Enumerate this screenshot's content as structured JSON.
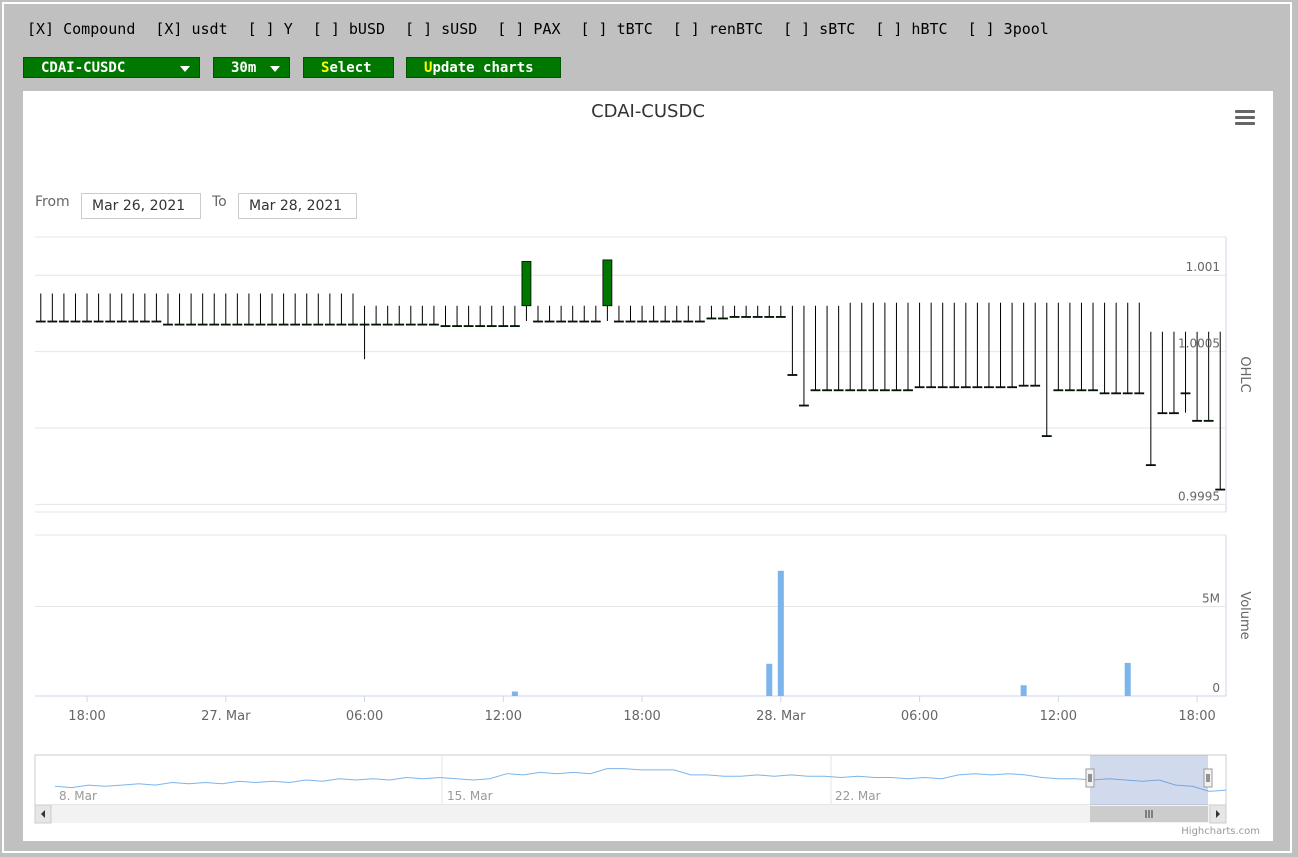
{
  "pools": [
    {
      "label": "[X] Compound"
    },
    {
      "label": "[X] usdt"
    },
    {
      "label": "[ ] Y"
    },
    {
      "label": "[ ] bUSD"
    },
    {
      "label": "[ ] sUSD"
    },
    {
      "label": "[ ] PAX"
    },
    {
      "label": "[ ] tBTC"
    },
    {
      "label": "[ ] renBTC"
    },
    {
      "label": "[ ] sBTC"
    },
    {
      "label": "[ ] hBTC"
    },
    {
      "label": "[ ] 3pool"
    }
  ],
  "controls": {
    "pair": "CDAI-CUSDC",
    "interval": "30m",
    "select_first": "S",
    "select_rest": "elect",
    "update_first": "U",
    "update_rest": "pdate charts",
    "accent": "#007800",
    "highlight": "#ffff00"
  },
  "range": {
    "from_label": "From",
    "from_value": "Mar 26, 2021",
    "to_label": "To",
    "to_value": "Mar 28, 2021"
  },
  "credit": "Highcharts.com",
  "chart_data": {
    "type": "candlestick",
    "title": "CDAI-CUSDC",
    "up_color": "#007800",
    "down_color": "#bb0000",
    "volume_color": "#7cb5ec",
    "ohlc": {
      "axis_title": "OHLC",
      "ylim": [
        0.99945,
        1.00125
      ],
      "ticks": [
        0.9995,
        1.0,
        1.0005,
        1.001
      ],
      "tick_labels": [
        "0.9995",
        "",
        "1.0005",
        "1.001"
      ],
      "candles": [
        [
          0,
          1.0007,
          1.00088,
          1.00088,
          1.0007
        ],
        [
          1,
          1.0007,
          1.00088,
          1.00088,
          1.0007
        ],
        [
          2,
          1.0007,
          1.00088,
          1.00088,
          1.0007
        ],
        [
          3,
          1.0007,
          1.00088,
          1.00088,
          1.0007
        ],
        [
          4,
          1.0007,
          1.00088,
          1.00088,
          1.0007
        ],
        [
          5,
          1.0007,
          1.00088,
          1.00088,
          1.0007
        ],
        [
          6,
          1.0007,
          1.00088,
          1.00088,
          1.0007
        ],
        [
          7,
          1.0007,
          1.00088,
          1.00088,
          1.0007
        ],
        [
          8,
          1.0007,
          1.00088,
          1.00088,
          1.0007
        ],
        [
          9,
          1.0007,
          1.00088,
          1.00088,
          1.0007
        ],
        [
          10,
          1.0007,
          1.00088,
          1.00088,
          1.0007
        ],
        [
          11,
          1.00068,
          1.00088,
          1.00088,
          1.00068
        ],
        [
          12,
          1.00068,
          1.00088,
          1.00088,
          1.00068
        ],
        [
          13,
          1.00068,
          1.00088,
          1.00088,
          1.00068
        ],
        [
          14,
          1.00068,
          1.00088,
          1.00088,
          1.00068
        ],
        [
          15,
          1.00068,
          1.00088,
          1.00088,
          1.00068
        ],
        [
          16,
          1.00068,
          1.00088,
          1.00088,
          1.00068
        ],
        [
          17,
          1.00068,
          1.00088,
          1.00088,
          1.00068
        ],
        [
          18,
          1.00068,
          1.00088,
          1.00088,
          1.00068
        ],
        [
          19,
          1.00068,
          1.00088,
          1.00088,
          1.00068
        ],
        [
          20,
          1.00068,
          1.00088,
          1.00088,
          1.00068
        ],
        [
          21,
          1.00068,
          1.00088,
          1.00088,
          1.00068
        ],
        [
          22,
          1.00068,
          1.00088,
          1.00088,
          1.00068
        ],
        [
          23,
          1.00068,
          1.00088,
          1.00088,
          1.00068
        ],
        [
          24,
          1.00068,
          1.00088,
          1.00088,
          1.00068
        ],
        [
          25,
          1.00068,
          1.00088,
          1.00088,
          1.00068
        ],
        [
          26,
          1.00068,
          1.00088,
          1.00088,
          1.00068
        ],
        [
          27,
          1.00068,
          1.00088,
          1.00088,
          1.00068
        ],
        [
          28,
          1.00068,
          1.0008,
          1.00045,
          1.00068
        ],
        [
          29,
          1.00068,
          1.0008,
          1.0008,
          1.00068
        ],
        [
          30,
          1.00068,
          1.0008,
          1.0008,
          1.00068
        ],
        [
          31,
          1.00068,
          1.0008,
          1.0008,
          1.00068
        ],
        [
          32,
          1.00068,
          1.0008,
          1.0008,
          1.00068
        ],
        [
          33,
          1.00068,
          1.0008,
          1.0008,
          1.00068
        ],
        [
          34,
          1.00068,
          1.0008,
          1.0008,
          1.00068
        ],
        [
          35,
          1.00067,
          1.0008,
          1.0008,
          1.00067
        ],
        [
          36,
          1.00067,
          1.0008,
          1.0008,
          1.00067
        ],
        [
          37,
          1.00067,
          1.0008,
          1.0008,
          1.00067
        ],
        [
          38,
          1.00067,
          1.0008,
          1.0008,
          1.00067
        ],
        [
          39,
          1.00067,
          1.0008,
          1.0008,
          1.00067
        ],
        [
          40,
          1.00067,
          1.0008,
          1.0008,
          1.00067
        ],
        [
          41,
          1.00067,
          1.0008,
          1.0008,
          1.00067
        ],
        [
          42,
          1.0008,
          1.00109,
          1.0007,
          1.00109
        ],
        [
          43,
          1.0007,
          1.0008,
          1.0008,
          1.0007
        ],
        [
          44,
          1.0007,
          1.0008,
          1.0008,
          1.0007
        ],
        [
          45,
          1.0007,
          1.0008,
          1.0008,
          1.0007
        ],
        [
          46,
          1.0007,
          1.0008,
          1.0008,
          1.0007
        ],
        [
          47,
          1.0007,
          1.0008,
          1.0008,
          1.0007
        ],
        [
          48,
          1.0007,
          1.0008,
          1.0008,
          1.0007
        ],
        [
          49,
          1.0008,
          1.0011,
          1.0007,
          1.0011
        ],
        [
          50,
          1.0007,
          1.0008,
          1.0008,
          1.0007
        ],
        [
          51,
          1.0007,
          1.0008,
          1.0008,
          1.0007
        ],
        [
          52,
          1.0007,
          1.0008,
          1.0008,
          1.0007
        ],
        [
          53,
          1.0007,
          1.0008,
          1.0008,
          1.0007
        ],
        [
          54,
          1.0007,
          1.0008,
          1.0008,
          1.0007
        ],
        [
          55,
          1.0007,
          1.0008,
          1.0008,
          1.0007
        ],
        [
          56,
          1.0007,
          1.0008,
          1.0008,
          1.0007
        ],
        [
          57,
          1.0007,
          1.0008,
          1.0008,
          1.0007
        ],
        [
          58,
          1.00072,
          1.0008,
          1.0008,
          1.00072
        ],
        [
          59,
          1.00072,
          1.0008,
          1.0008,
          1.00072
        ],
        [
          60,
          1.00073,
          1.0008,
          1.0008,
          1.00073
        ],
        [
          61,
          1.00073,
          1.0008,
          1.0008,
          1.00073
        ],
        [
          62,
          1.00073,
          1.0008,
          1.0008,
          1.00073
        ],
        [
          63,
          1.00073,
          1.0008,
          1.0008,
          1.00073
        ],
        [
          64,
          1.00073,
          1.0008,
          1.0008,
          1.00073
        ],
        [
          65,
          1.00035,
          1.0008,
          1.0008,
          1.00035
        ],
        [
          66,
          1.00015,
          1.0008,
          1.0008,
          1.00015
        ],
        [
          67,
          1.00025,
          1.0008,
          1.0008,
          1.00025
        ],
        [
          68,
          1.00025,
          1.0008,
          1.0008,
          1.00025
        ],
        [
          69,
          1.00025,
          1.0008,
          1.0008,
          1.00025
        ],
        [
          70,
          1.00025,
          1.00082,
          1.00082,
          1.00025
        ],
        [
          71,
          1.00025,
          1.00082,
          1.00082,
          1.00025
        ],
        [
          72,
          1.00025,
          1.00082,
          1.00082,
          1.00025
        ],
        [
          73,
          1.00025,
          1.00082,
          1.00082,
          1.00025
        ],
        [
          74,
          1.00025,
          1.00082,
          1.00082,
          1.00025
        ],
        [
          75,
          1.00025,
          1.00082,
          1.00082,
          1.00025
        ],
        [
          76,
          1.00027,
          1.00082,
          1.00082,
          1.00027
        ],
        [
          77,
          1.00027,
          1.00082,
          1.00082,
          1.00027
        ],
        [
          78,
          1.00027,
          1.00082,
          1.00082,
          1.00027
        ],
        [
          79,
          1.00027,
          1.00082,
          1.00082,
          1.00027
        ],
        [
          80,
          1.00027,
          1.00082,
          1.00082,
          1.00027
        ],
        [
          81,
          1.00027,
          1.00082,
          1.00082,
          1.00027
        ],
        [
          82,
          1.00027,
          1.00082,
          1.00082,
          1.00027
        ],
        [
          83,
          1.00027,
          1.00082,
          1.00082,
          1.00027
        ],
        [
          84,
          1.00027,
          1.00082,
          1.00082,
          1.00027
        ],
        [
          85,
          1.00028,
          1.00082,
          1.00082,
          1.00028
        ],
        [
          86,
          1.00028,
          1.00082,
          1.00082,
          1.00028
        ],
        [
          87,
          0.99995,
          1.00082,
          1.00082,
          0.99995
        ],
        [
          88,
          1.00025,
          1.00082,
          1.00082,
          1.00025
        ],
        [
          89,
          1.00025,
          1.00082,
          1.00082,
          1.00025
        ],
        [
          90,
          1.00025,
          1.00082,
          1.00082,
          1.00025
        ],
        [
          91,
          1.00025,
          1.00082,
          1.00082,
          1.00025
        ],
        [
          92,
          1.00023,
          1.00082,
          1.00082,
          1.00023
        ],
        [
          93,
          1.00023,
          1.00082,
          1.00082,
          1.00023
        ],
        [
          94,
          1.00023,
          1.00082,
          1.00082,
          1.00023
        ],
        [
          95,
          1.00023,
          1.00082,
          1.00082,
          1.00023
        ],
        [
          96,
          0.99976,
          1.00063,
          1.00063,
          0.99976
        ],
        [
          97,
          1.0001,
          1.00063,
          1.00063,
          1.0001
        ],
        [
          98,
          1.0001,
          1.00063,
          1.00063,
          1.0001
        ],
        [
          99,
          1.00023,
          1.00063,
          1.0001,
          1.00023
        ],
        [
          100,
          1.00005,
          1.00063,
          1.00063,
          1.00005
        ],
        [
          101,
          1.00005,
          1.00063,
          1.00063,
          1.00005
        ],
        [
          102,
          0.9996,
          1.00063,
          1.00063,
          0.9996
        ]
      ]
    },
    "volume": {
      "axis_title": "Volume",
      "ylim": [
        0,
        9000000
      ],
      "ticks": [
        0,
        5000000
      ],
      "tick_labels": [
        "0",
        "5M"
      ],
      "bars": [
        [
          41,
          250000
        ],
        [
          63,
          1800000
        ],
        [
          64,
          7000000
        ],
        [
          85,
          600000
        ],
        [
          94,
          1850000
        ]
      ]
    },
    "x_axis": {
      "ticks": [
        {
          "at": 4,
          "label": "18:00"
        },
        {
          "at": 16,
          "label": "27. Mar"
        },
        {
          "at": 28,
          "label": "06:00"
        },
        {
          "at": 40,
          "label": "12:00"
        },
        {
          "at": 52,
          "label": "18:00"
        },
        {
          "at": 64,
          "label": "28. Mar"
        },
        {
          "at": 76,
          "label": "06:00"
        },
        {
          "at": 88,
          "label": "12:00"
        },
        {
          "at": 100,
          "label": "18:00"
        }
      ]
    },
    "navigator": {
      "labels": [
        "8. Mar",
        "15. Mar",
        "22. Mar"
      ],
      "series": [
        0.995,
        0.994,
        0.996,
        0.995,
        0.996,
        0.997,
        0.996,
        0.998,
        0.997,
        0.998,
        0.997,
        0.999,
        0.998,
        0.999,
        0.998,
        1.0,
        0.999,
        1.001,
        1.0,
        1.001,
        1.0,
        1.002,
        1.001,
        1.002,
        1.001,
        1.0,
        1.001,
        1.005,
        1.004,
        1.006,
        1.005,
        1.006,
        1.005,
        1.009,
        1.009,
        1.008,
        1.008,
        1.008,
        1.004,
        1.004,
        1.003,
        1.003,
        1.004,
        1.003,
        1.004,
        1.003,
        1.003,
        1.002,
        1.003,
        1.002,
        1.002,
        1.001,
        1.002,
        1.001,
        1.004,
        1.005,
        1.004,
        1.005,
        1.004,
        1.002,
        1.001,
        1.001,
        1.0,
        1.001,
        1.0,
        0.999,
        1.0,
        0.996,
        0.995,
        0.991,
        0.992
      ]
    }
  }
}
